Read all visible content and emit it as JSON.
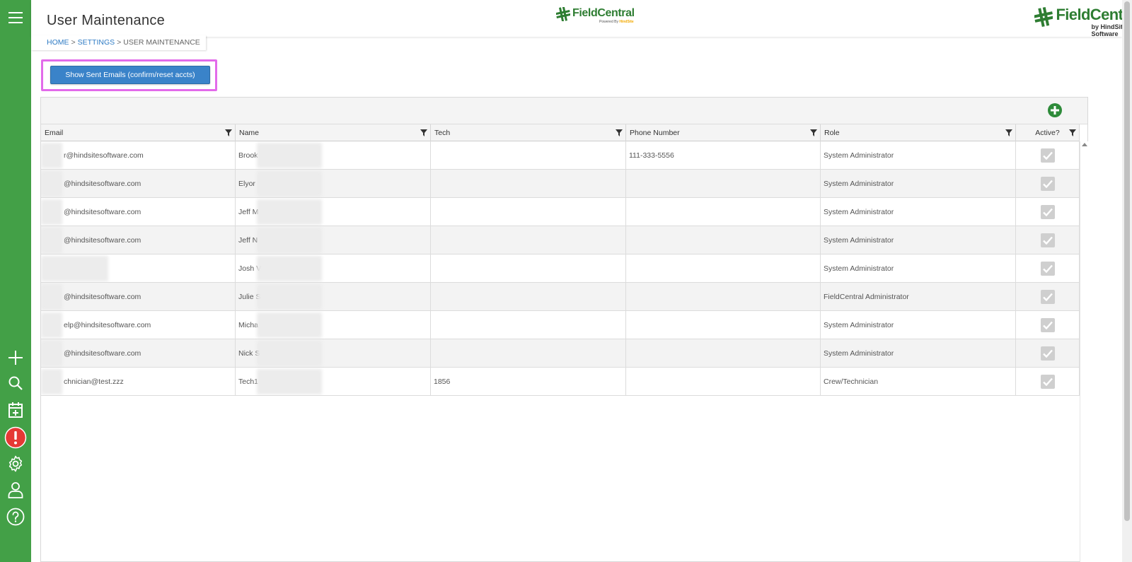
{
  "header": {
    "title": "User Maintenance",
    "breadcrumb": {
      "home": "HOME",
      "settings": "SETTINGS",
      "current": "USER MAINTENANCE",
      "separator": ">"
    },
    "logo_center": {
      "name": "FieldCentral",
      "powered_by": "Powered By",
      "hindsite": "HindSite"
    },
    "logo_right": {
      "name": "FieldCentral",
      "byline": "by HindSite Software"
    }
  },
  "sidebar": {
    "items": [
      {
        "icon": "hamburger-menu-icon"
      },
      {
        "icon": "plus-icon"
      },
      {
        "icon": "search-icon"
      },
      {
        "icon": "calendar-add-icon"
      },
      {
        "icon": "alert-icon",
        "label": "!"
      },
      {
        "icon": "gear-icon"
      },
      {
        "icon": "user-icon"
      },
      {
        "icon": "help-icon",
        "label": "?"
      }
    ]
  },
  "toolbar": {
    "sent_emails_label": "Show Sent Emails (confirm/reset accts)"
  },
  "grid": {
    "columns": [
      "Email",
      "Name",
      "Tech",
      "Phone Number",
      "Role",
      "Active?"
    ],
    "rows": [
      {
        "email": "r@hindsitesoftware.com",
        "name": "Brook",
        "tech": "",
        "phone": "111-333-5556",
        "role": "System Administrator",
        "active": true
      },
      {
        "email": "@hindsitesoftware.com",
        "name": "Elyor",
        "tech": "",
        "phone": "",
        "role": "System Administrator",
        "active": true
      },
      {
        "email": "@hindsitesoftware.com",
        "name": "Jeff M",
        "tech": "",
        "phone": "",
        "role": "System Administrator",
        "active": true
      },
      {
        "email": "@hindsitesoftware.com",
        "name": "Jeff N",
        "tech": "",
        "phone": "",
        "role": "System Administrator",
        "active": true
      },
      {
        "email": "",
        "name": "Josh V",
        "tech": "",
        "phone": "",
        "role": "System Administrator",
        "active": true
      },
      {
        "email": "@hindsitesoftware.com",
        "name": "Julie S",
        "tech": "",
        "phone": "",
        "role": "FieldCentral Administrator",
        "active": true
      },
      {
        "email": "elp@hindsitesoftware.com",
        "name": "Micha",
        "tech": "",
        "phone": "",
        "role": "System Administrator",
        "active": true
      },
      {
        "email": "@hindsitesoftware.com",
        "name": "Nick S",
        "tech": "",
        "phone": "",
        "role": "System Administrator",
        "active": true
      },
      {
        "email": "chnician@test.zzz",
        "name": "Tech1",
        "tech": "1856",
        "phone": "",
        "role": "Crew/Technician",
        "active": true
      }
    ]
  },
  "colors": {
    "sidebar": "#43a047",
    "brand_green": "#2e7d32",
    "button_blue": "#3a83c9",
    "highlight": "#e26bea",
    "alert_red": "#e53935"
  }
}
